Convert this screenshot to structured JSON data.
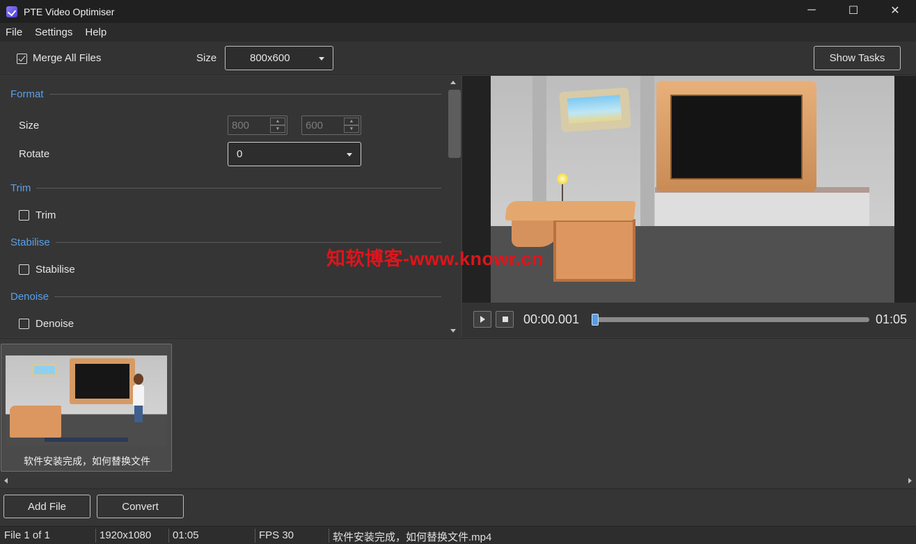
{
  "window": {
    "title": "PTE Video Optimiser",
    "icon": "app-logo-icon",
    "controls": {
      "minimize": "─",
      "maximize": "☐",
      "close": "✕"
    }
  },
  "menu": {
    "items": [
      "File",
      "Settings",
      "Help"
    ]
  },
  "toolbar": {
    "merge_label": "Merge All Files",
    "merge_checked": true,
    "size_label": "Size",
    "size_value": "800x600",
    "show_tasks": "Show Tasks"
  },
  "settings": {
    "format": {
      "heading": "Format",
      "size_label": "Size",
      "width": "800",
      "height": "600",
      "rotate_label": "Rotate",
      "rotate_value": "0"
    },
    "trim": {
      "heading": "Trim",
      "checkbox_label": "Trim",
      "checked": false
    },
    "stabilise": {
      "heading": "Stabilise",
      "checkbox_label": "Stabilise",
      "checked": false
    },
    "denoise": {
      "heading": "Denoise",
      "checkbox_label": "Denoise",
      "checked": false
    }
  },
  "player": {
    "current_time": "00:00.001",
    "duration": "01:05",
    "progress_fraction": 0.0
  },
  "files": [
    {
      "name": "软件安装完成，如何替换文件"
    }
  ],
  "actions": {
    "add_file": "Add File",
    "convert": "Convert"
  },
  "status": {
    "file_index": "File 1 of 1",
    "resolution": "1920x1080",
    "duration": "01:05",
    "fps": "FPS 30",
    "filename": "软件安装完成，如何替换文件.mp4"
  },
  "watermark": "知软博客-www.knowr.cn",
  "colors": {
    "accent": "#5aa0e8",
    "watermark": "#e0141b",
    "progress": "#4a90d9"
  }
}
